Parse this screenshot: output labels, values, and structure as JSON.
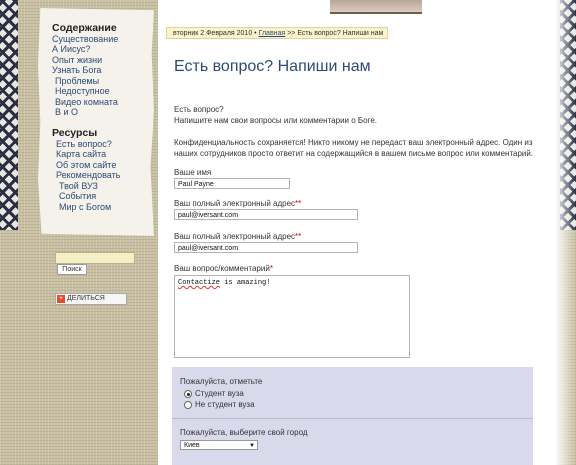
{
  "sidebar": {
    "contents_heading": "Содержание",
    "contents_items": [
      "Существование",
      "А Иисус?",
      "Опыт жизни",
      "Узнать Бога",
      "Проблемы",
      "Недоступное",
      "Видео комната",
      "В и О"
    ],
    "resources_heading": "Ресурсы",
    "resources_items": [
      "Есть вопрос?",
      "Карта сайта",
      "Об этом сайте",
      "Рекомендовать",
      "Твой ВУЗ",
      "События",
      "Мир с Богом"
    ],
    "search_button": "Поиск",
    "share_label": "ДЕЛИТЬСЯ"
  },
  "breadcrumb": {
    "date": "вторник 2 Февраля 2010",
    "separator": "•",
    "home": "Главная",
    "arrow": ">>",
    "current": "Есть вопрос? Напиши нам"
  },
  "page": {
    "title": "Есть вопрос? Напиши нам",
    "intro_line1": "Есть вопрос?",
    "intro_line2": "Напишите нам свои вопросы или комментарии о Боге.",
    "privacy_line1": "Конфиденциальность сохраняется! Никто никому не передаст ваш электронный адрес. Один из",
    "privacy_line2": "наших сотрудников просто ответит на содержащийся в вашем письме вопрос или комментарий."
  },
  "form": {
    "name_label": "Ваше имя",
    "name_value": "Paul Payne",
    "email_label": "Ваш полный электронный адрес",
    "email_value": "paul@iversant.com",
    "email_confirm_label": "Ваш полный электронный адрес",
    "email_confirm_value": "paul@iversant.com",
    "required_mark": "**",
    "comment_label": "Ваш вопрос/комментарий",
    "comment_required": "*",
    "comment_value_word": "Contactize",
    "comment_value_rest": " is amazing!",
    "status_label": "Пожалуйста, отметьте",
    "status_options": [
      "Студент вуза",
      "Не студент вуза"
    ],
    "status_selected": 0,
    "city_label": "Пожалуйста, выберите свой город",
    "city_value": "Киев"
  },
  "colors": {
    "link": "#2c4a78",
    "panel": "#d9d9ec",
    "breadcrumb_bg": "#faf3cc",
    "required": "#cc0000"
  }
}
